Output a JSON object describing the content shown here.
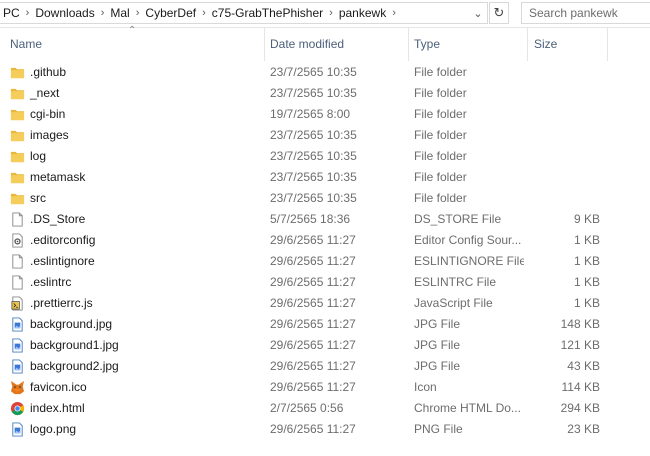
{
  "address": {
    "crumbs": [
      "PC",
      "Downloads",
      "Mal",
      "CyberDef",
      "c75-GrabThePhisher",
      "pankewk"
    ],
    "separator": "›"
  },
  "search": {
    "placeholder": "Search pankewk"
  },
  "columns": {
    "name": "Name",
    "date": "Date modified",
    "type": "Type",
    "size": "Size"
  },
  "files": [
    {
      "name": ".github",
      "date": "23/7/2565 10:35",
      "type": "File folder",
      "size": "",
      "icon": "folder-icon"
    },
    {
      "name": "_next",
      "date": "23/7/2565 10:35",
      "type": "File folder",
      "size": "",
      "icon": "folder-icon"
    },
    {
      "name": "cgi-bin",
      "date": "19/7/2565 8:00",
      "type": "File folder",
      "size": "",
      "icon": "folder-icon"
    },
    {
      "name": "images",
      "date": "23/7/2565 10:35",
      "type": "File folder",
      "size": "",
      "icon": "folder-icon"
    },
    {
      "name": "log",
      "date": "23/7/2565 10:35",
      "type": "File folder",
      "size": "",
      "icon": "folder-icon"
    },
    {
      "name": "metamask",
      "date": "23/7/2565 10:35",
      "type": "File folder",
      "size": "",
      "icon": "folder-icon"
    },
    {
      "name": "src",
      "date": "23/7/2565 10:35",
      "type": "File folder",
      "size": "",
      "icon": "folder-icon"
    },
    {
      "name": ".DS_Store",
      "date": "5/7/2565 18:36",
      "type": "DS_STORE File",
      "size": "9 KB",
      "icon": "blank-file-icon"
    },
    {
      "name": ".editorconfig",
      "date": "29/6/2565 11:27",
      "type": "Editor Config Sour...",
      "size": "1 KB",
      "icon": "config-file-icon"
    },
    {
      "name": ".eslintignore",
      "date": "29/6/2565 11:27",
      "type": "ESLINTIGNORE File",
      "size": "1 KB",
      "icon": "blank-file-icon"
    },
    {
      "name": ".eslintrc",
      "date": "29/6/2565 11:27",
      "type": "ESLINTRC File",
      "size": "1 KB",
      "icon": "blank-file-icon"
    },
    {
      "name": ".prettierrc.js",
      "date": "29/6/2565 11:27",
      "type": "JavaScript File",
      "size": "1 KB",
      "icon": "javascript-file-icon"
    },
    {
      "name": "background.jpg",
      "date": "29/6/2565 11:27",
      "type": "JPG File",
      "size": "148 KB",
      "icon": "image-file-icon"
    },
    {
      "name": "background1.jpg",
      "date": "29/6/2565 11:27",
      "type": "JPG File",
      "size": "121 KB",
      "icon": "image-file-icon"
    },
    {
      "name": "background2.jpg",
      "date": "29/6/2565 11:27",
      "type": "JPG File",
      "size": "43 KB",
      "icon": "image-file-icon"
    },
    {
      "name": "favicon.ico",
      "date": "29/6/2565 11:27",
      "type": "Icon",
      "size": "114 KB",
      "icon": "metamask-fox-icon"
    },
    {
      "name": "index.html",
      "date": "2/7/2565 0:56",
      "type": "Chrome HTML Do...",
      "size": "294 KB",
      "icon": "chrome-icon"
    },
    {
      "name": "logo.png",
      "date": "29/6/2565 11:27",
      "type": "PNG File",
      "size": "23 KB",
      "icon": "image-file-icon"
    }
  ],
  "colors": {
    "header_text": "#4c607a",
    "folder": "#e8b83a",
    "secondary_text": "#6d6d6d"
  }
}
